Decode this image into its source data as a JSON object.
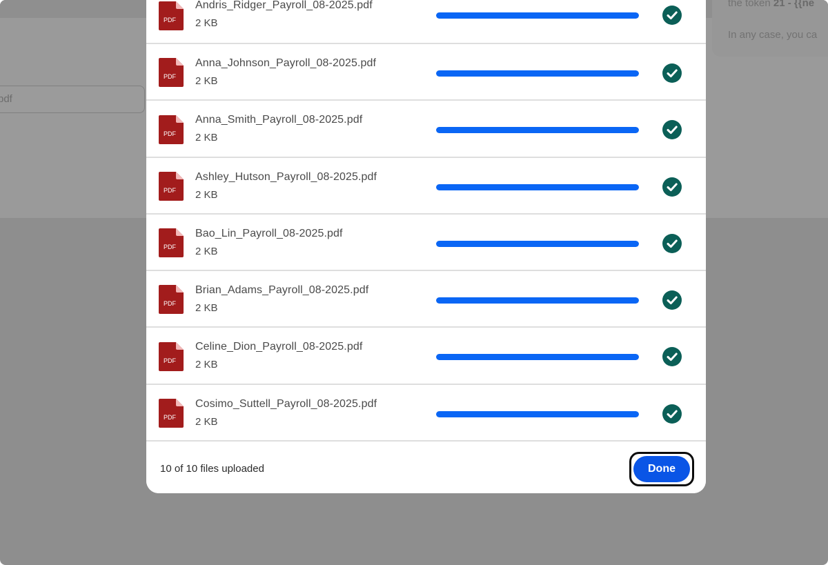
{
  "background": {
    "input_value": "pdf",
    "card_line_1_prefix": "the token ",
    "card_line_1_bold": "21 - {{ne",
    "card_line_2": "In any case, you ca"
  },
  "files": [
    {
      "name": "Andris_Ridger_Payroll_08-2025.pdf",
      "size": "2 KB",
      "progress": 1.0,
      "icon": "pdf-file-icon",
      "status_icon": "check-circle-icon"
    },
    {
      "name": "Anna_Johnson_Payroll_08-2025.pdf",
      "size": "2 KB",
      "progress": 1.0,
      "icon": "pdf-file-icon",
      "status_icon": "check-circle-icon"
    },
    {
      "name": "Anna_Smith_Payroll_08-2025.pdf",
      "size": "2 KB",
      "progress": 1.0,
      "icon": "pdf-file-icon",
      "status_icon": "check-circle-icon"
    },
    {
      "name": "Ashley_Hutson_Payroll_08-2025.pdf",
      "size": "2 KB",
      "progress": 1.0,
      "icon": "pdf-file-icon",
      "status_icon": "check-circle-icon"
    },
    {
      "name": "Bao_Lin_Payroll_08-2025.pdf",
      "size": "2 KB",
      "progress": 1.0,
      "icon": "pdf-file-icon",
      "status_icon": "check-circle-icon"
    },
    {
      "name": "Brian_Adams_Payroll_08-2025.pdf",
      "size": "2 KB",
      "progress": 1.0,
      "icon": "pdf-file-icon",
      "status_icon": "check-circle-icon"
    },
    {
      "name": "Celine_Dion_Payroll_08-2025.pdf",
      "size": "2 KB",
      "progress": 1.0,
      "icon": "pdf-file-icon",
      "status_icon": "check-circle-icon"
    },
    {
      "name": "Cosimo_Suttell_Payroll_08-2025.pdf",
      "size": "2 KB",
      "progress": 1.0,
      "icon": "pdf-file-icon",
      "status_icon": "check-circle-icon"
    }
  ],
  "pdf_badge": "PDF",
  "footer": {
    "status": "10 of 10 files uploaded",
    "done_label": "Done"
  },
  "colors": {
    "progress": "#0a66f5",
    "check": "#0b5f57",
    "pdf_icon": "#a21c1c",
    "done_button": "#0a55e6",
    "overlay": "#8e8e8e"
  }
}
